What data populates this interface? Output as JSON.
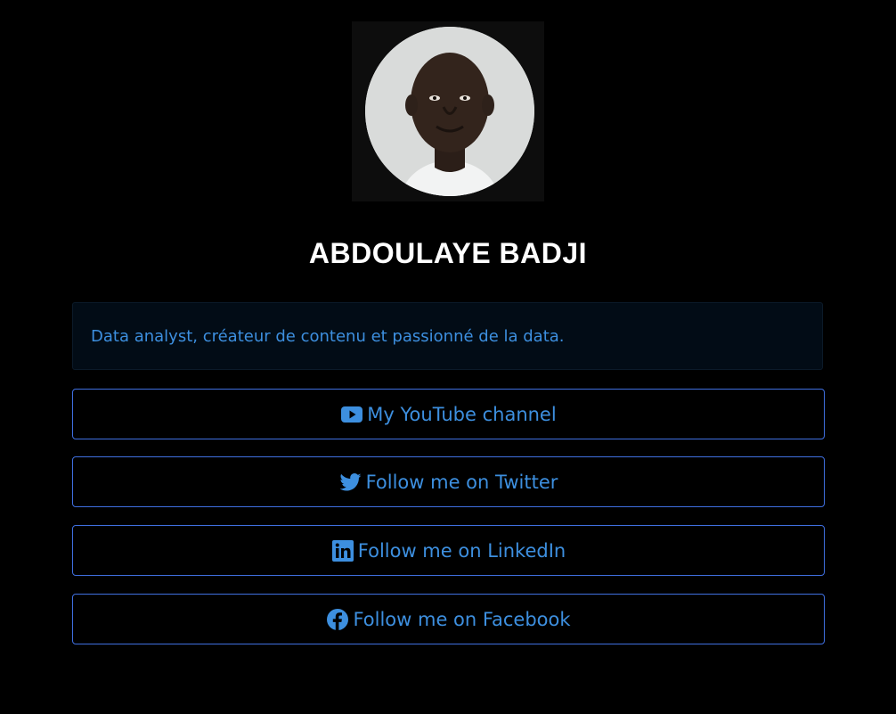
{
  "profile": {
    "name": "ABDOULAYE BADJI",
    "bio": "Data analyst, créateur de contenu et passionné de la data."
  },
  "links": [
    {
      "label": "My YouTube channel",
      "icon": "youtube-icon"
    },
    {
      "label": "Follow me on Twitter",
      "icon": "twitter-icon"
    },
    {
      "label": "Follow me on LinkedIn",
      "icon": "linkedin-icon"
    },
    {
      "label": "Follow me on Facebook",
      "icon": "facebook-icon"
    }
  ],
  "colors": {
    "background": "#000000",
    "accent": "#3d8fdf",
    "button_border": "#3f6fe0",
    "bio_background": "#020c16"
  }
}
